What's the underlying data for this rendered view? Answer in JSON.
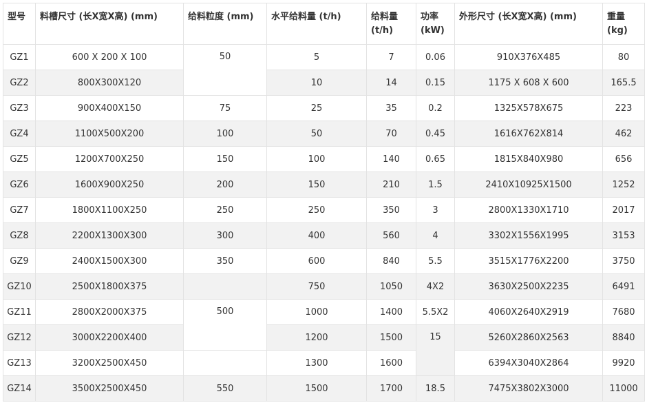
{
  "headers": {
    "model": "型号",
    "trough": "料槽尺寸 (长X宽X高) (mm)",
    "granularity": "给料粒度 (mm)",
    "horizontal": "水平给料量 (t/h)",
    "feed": "给料量 (t/h)",
    "power": "功率 (kW)",
    "outline": "外形尺寸 (长X宽X高) (mm)",
    "weight": "重量 (kg)"
  },
  "rows": [
    {
      "model": "GZ1",
      "trough": "600 X 200 X 100",
      "granularity": "50",
      "horizontal": "5",
      "feed": "7",
      "power": "0.06",
      "outline": "910X376X485",
      "weight": "80"
    },
    {
      "model": "GZ2",
      "trough": "800X300X120",
      "granularity": "",
      "horizontal": "10",
      "feed": "14",
      "power": "0.15",
      "outline": "1175 X 608 X 600",
      "weight": "165.5"
    },
    {
      "model": "GZ3",
      "trough": "900X400X150",
      "granularity": "75",
      "horizontal": "25",
      "feed": "35",
      "power": "0.2",
      "outline": "1325X578X675",
      "weight": "223"
    },
    {
      "model": "GZ4",
      "trough": "1100X500X200",
      "granularity": "100",
      "horizontal": "50",
      "feed": "70",
      "power": "0.45",
      "outline": "1616X762X814",
      "weight": "462"
    },
    {
      "model": "GZ5",
      "trough": "1200X700X250",
      "granularity": "150",
      "horizontal": "100",
      "feed": "140",
      "power": "0.65",
      "outline": "1815X840X980",
      "weight": "656"
    },
    {
      "model": "GZ6",
      "trough": "1600X900X250",
      "granularity": "200",
      "horizontal": "150",
      "feed": "210",
      "power": "1.5",
      "outline": "2410X10925X1500",
      "weight": "1252"
    },
    {
      "model": "GZ7",
      "trough": "1800X1100X250",
      "granularity": "250",
      "horizontal": "250",
      "feed": "350",
      "power": "3",
      "outline": "2800X1330X1710",
      "weight": "2017"
    },
    {
      "model": "GZ8",
      "trough": "2200X1300X300",
      "granularity": "300",
      "horizontal": "400",
      "feed": "560",
      "power": "4",
      "outline": "3302X1556X1995",
      "weight": "3153"
    },
    {
      "model": "GZ9",
      "trough": "2400X1500X300",
      "granularity": "350",
      "horizontal": "600",
      "feed": "840",
      "power": "5.5",
      "outline": "3515X1776X2200",
      "weight": "3750"
    },
    {
      "model": "GZ10",
      "trough": "2500X1800X375",
      "granularity": "",
      "horizontal": "750",
      "feed": "1050",
      "power": "4X2",
      "outline": "3630X2500X2235",
      "weight": "6491"
    },
    {
      "model": "GZ11",
      "trough": "2800X2000X375",
      "granularity": "500",
      "horizontal": "1000",
      "feed": "1400",
      "power": "5.5X2",
      "outline": "4060X2640X2919",
      "weight": "7680"
    },
    {
      "model": "GZ12",
      "trough": "3000X2200X400",
      "granularity": "",
      "horizontal": "1200",
      "feed": "1500",
      "power": "15",
      "outline": "5260X2860X2563",
      "weight": "8840"
    },
    {
      "model": "GZ13",
      "trough": "3200X2500X450",
      "granularity": "",
      "horizontal": "1300",
      "feed": "1600",
      "power": "",
      "outline": "6394X3040X2864",
      "weight": "9920"
    },
    {
      "model": "GZ14",
      "trough": "3500X2500X450",
      "granularity": "550",
      "horizontal": "1500",
      "feed": "1700",
      "power": "18.5",
      "outline": "7475X3802X3000",
      "weight": "11000"
    }
  ]
}
